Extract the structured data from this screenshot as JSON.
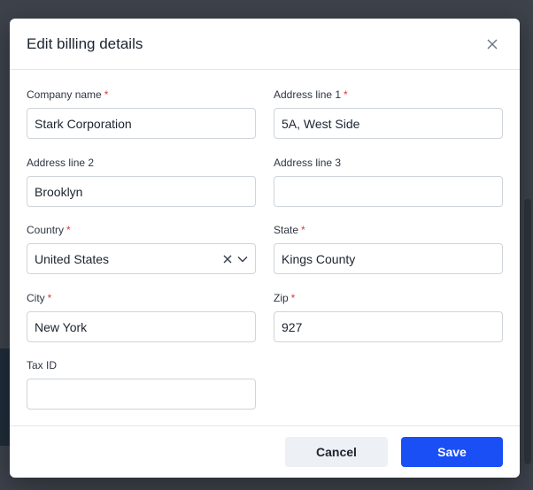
{
  "modal": {
    "title": "Edit billing details",
    "fields": {
      "company_name": {
        "label": "Company name",
        "required_mark": "*",
        "value": "Stark Corporation"
      },
      "address_line_1": {
        "label": "Address line 1",
        "required_mark": "*",
        "value": "5A, West Side"
      },
      "address_line_2": {
        "label": "Address line 2",
        "value": "Brooklyn"
      },
      "address_line_3": {
        "label": "Address line 3",
        "value": ""
      },
      "country": {
        "label": "Country",
        "required_mark": "*",
        "value": "United States"
      },
      "state": {
        "label": "State",
        "required_mark": "*",
        "value": "Kings County"
      },
      "city": {
        "label": "City",
        "required_mark": "*",
        "value": "New York"
      },
      "zip": {
        "label": "Zip",
        "required_mark": "*",
        "value": "927"
      },
      "tax_id": {
        "label": "Tax ID",
        "value": ""
      }
    },
    "footer": {
      "cancel_label": "Cancel",
      "save_label": "Save"
    }
  },
  "icons": {
    "close": "close-icon",
    "clear": "clear-icon",
    "dropdown": "chevron-down-icon"
  },
  "colors": {
    "primary": "#1a4ff5",
    "required": "#e5343a",
    "cancel_bg": "#edf0f4"
  }
}
